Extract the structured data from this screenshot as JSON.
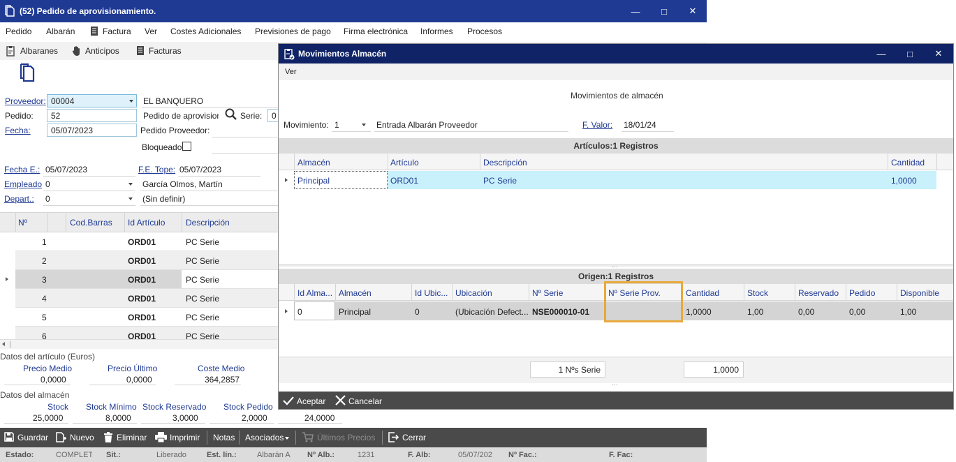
{
  "main": {
    "title": "(52)  Pedido de aprovisionamiento.",
    "menu": [
      "Pedido",
      "Albarán",
      "Factura",
      "Ver",
      "Costes Adicionales",
      "Previsiones de pago",
      "Firma electrónica",
      "Informes",
      "Procesos"
    ],
    "toolbar": [
      "Albaranes",
      "Anticipos",
      "Facturas"
    ],
    "form": {
      "proveedor_label": "Proveedor:",
      "proveedor_value": "00004",
      "proveedor_name": "EL BANQUERO",
      "pedido_label": "Pedido:",
      "pedido_value": "52",
      "pedido_desc": "Pedido de aprovisior",
      "serie_label": "Serie:",
      "serie_value": "0",
      "fecha_label": "Fecha:",
      "fecha_value": "05/07/2023",
      "pedido_proveedor_label": "Pedido Proveedor:",
      "bloqueado_label": "Bloqueado",
      "fecha_e_label": "Fecha E.:",
      "fecha_e_value": "05/07/2023",
      "fe_tope_label": "F.E. Tope:",
      "fe_tope_value": "05/07/2023",
      "empleado_label": "Empleado",
      "empleado_value": "0",
      "empleado_name": "García Olmos, Martín",
      "depart_label": "Depart.:",
      "depart_value": "0",
      "depart_name": "(Sin definir)"
    },
    "grid": {
      "headers": [
        "Nº",
        "Cod.Barras",
        "Id Artículo",
        "Descripción"
      ],
      "rows": [
        {
          "n": "1",
          "id": "ORD01",
          "desc": "PC Serie"
        },
        {
          "n": "2",
          "id": "ORD01",
          "desc": "PC Serie"
        },
        {
          "n": "3",
          "id": "ORD01",
          "desc": "PC Serie"
        },
        {
          "n": "4",
          "id": "ORD01",
          "desc": "PC Serie"
        },
        {
          "n": "5",
          "id": "ORD01",
          "desc": "PC Serie"
        },
        {
          "n": "6",
          "id": "ORD01",
          "desc": "PC Serie"
        }
      ],
      "selected_row": 2
    },
    "articulo": {
      "section_label": "Datos del artículo (Euros)",
      "precio_medio_label": "Precio Medio",
      "precio_medio": "0,0000",
      "precio_ultimo_label": "Precio Último",
      "precio_ultimo": "0,0000",
      "coste_medio_label": "Coste Medio",
      "coste_medio": "364,2857"
    },
    "almacen": {
      "section_label": "Datos del almacén",
      "stock_label": "Stock",
      "stock": "25,0000",
      "stock_minimo_label": "Stock Mínimo",
      "stock_minimo": "8,0000",
      "stock_reservado_label": "Stock Reservado",
      "stock_reservado": "3,0000",
      "stock_pedido_label": "Stock Pedido",
      "stock_pedido": "2,0000",
      "extra": "24,0000"
    },
    "bottom": [
      "Guardar",
      "Nuevo",
      "Eliminar",
      "Imprimir",
      "Notas",
      "Asociados",
      "Últimos Precios",
      "Cerrar"
    ],
    "status": {
      "estado_label": "Estado:",
      "estado": "COMPLET",
      "sit_label": "Sit.:",
      "sit": "Liberado",
      "est_lin_label": "Est. lín.:",
      "est_lin": "Albarán A",
      "n_alb_label": "Nº Alb.:",
      "n_alb": "1231",
      "f_alb_label": "F. Alb:",
      "f_alb": "05/07/202",
      "n_fac_label": "Nº Fac.:",
      "n_fac": "",
      "f_fac_label": "F. Fac:",
      "f_fac": ""
    }
  },
  "dialog": {
    "title": "Movimientos Almacén",
    "menu": [
      "Ver"
    ],
    "heading": "Movimientos de almacén",
    "movimiento_label": "Movimiento:",
    "movimiento_value": "1",
    "movimiento_desc": "Entrada Albarán Proveedor",
    "fvalor_label": "F. Valor:",
    "fvalor_value": "18/01/24",
    "articulos": {
      "title": "Artículos:1 Registros",
      "headers": [
        "Almacén",
        "Artículo",
        "Descripción",
        "Cantidad"
      ],
      "row": {
        "almacen": "Principal",
        "articulo": "ORD01",
        "descripcion": "PC Serie",
        "cantidad": "1,0000"
      }
    },
    "origen": {
      "title": "Origen:1 Registros",
      "headers": [
        "Id Alma...",
        "Almacén",
        "Id Ubic...",
        "Ubicación",
        "Nº Serie",
        "Nº Serie Prov.",
        "Cantidad",
        "Stock",
        "Reservado",
        "Pedido",
        "Disponible"
      ],
      "row": {
        "id_alma": "0",
        "almacen": "Principal",
        "id_ubic": "0",
        "ubicacion": "(Ubicación Defect...",
        "n_serie": "NSE000010-01",
        "n_serie_prov": "",
        "cantidad": "1,0000",
        "stock": "1,00",
        "reservado": "0,00",
        "pedido": "0,00",
        "disponible": "1,00"
      }
    },
    "totals": {
      "series": "1 Nºs Serie",
      "cantidad": "1,0000"
    },
    "buttons": {
      "accept": "Aceptar",
      "cancel": "Cancelar"
    },
    "colors": {
      "title_bg": "#0f2366",
      "highlight": "#e8a93a",
      "selected_row": "#c8f1fb"
    }
  }
}
